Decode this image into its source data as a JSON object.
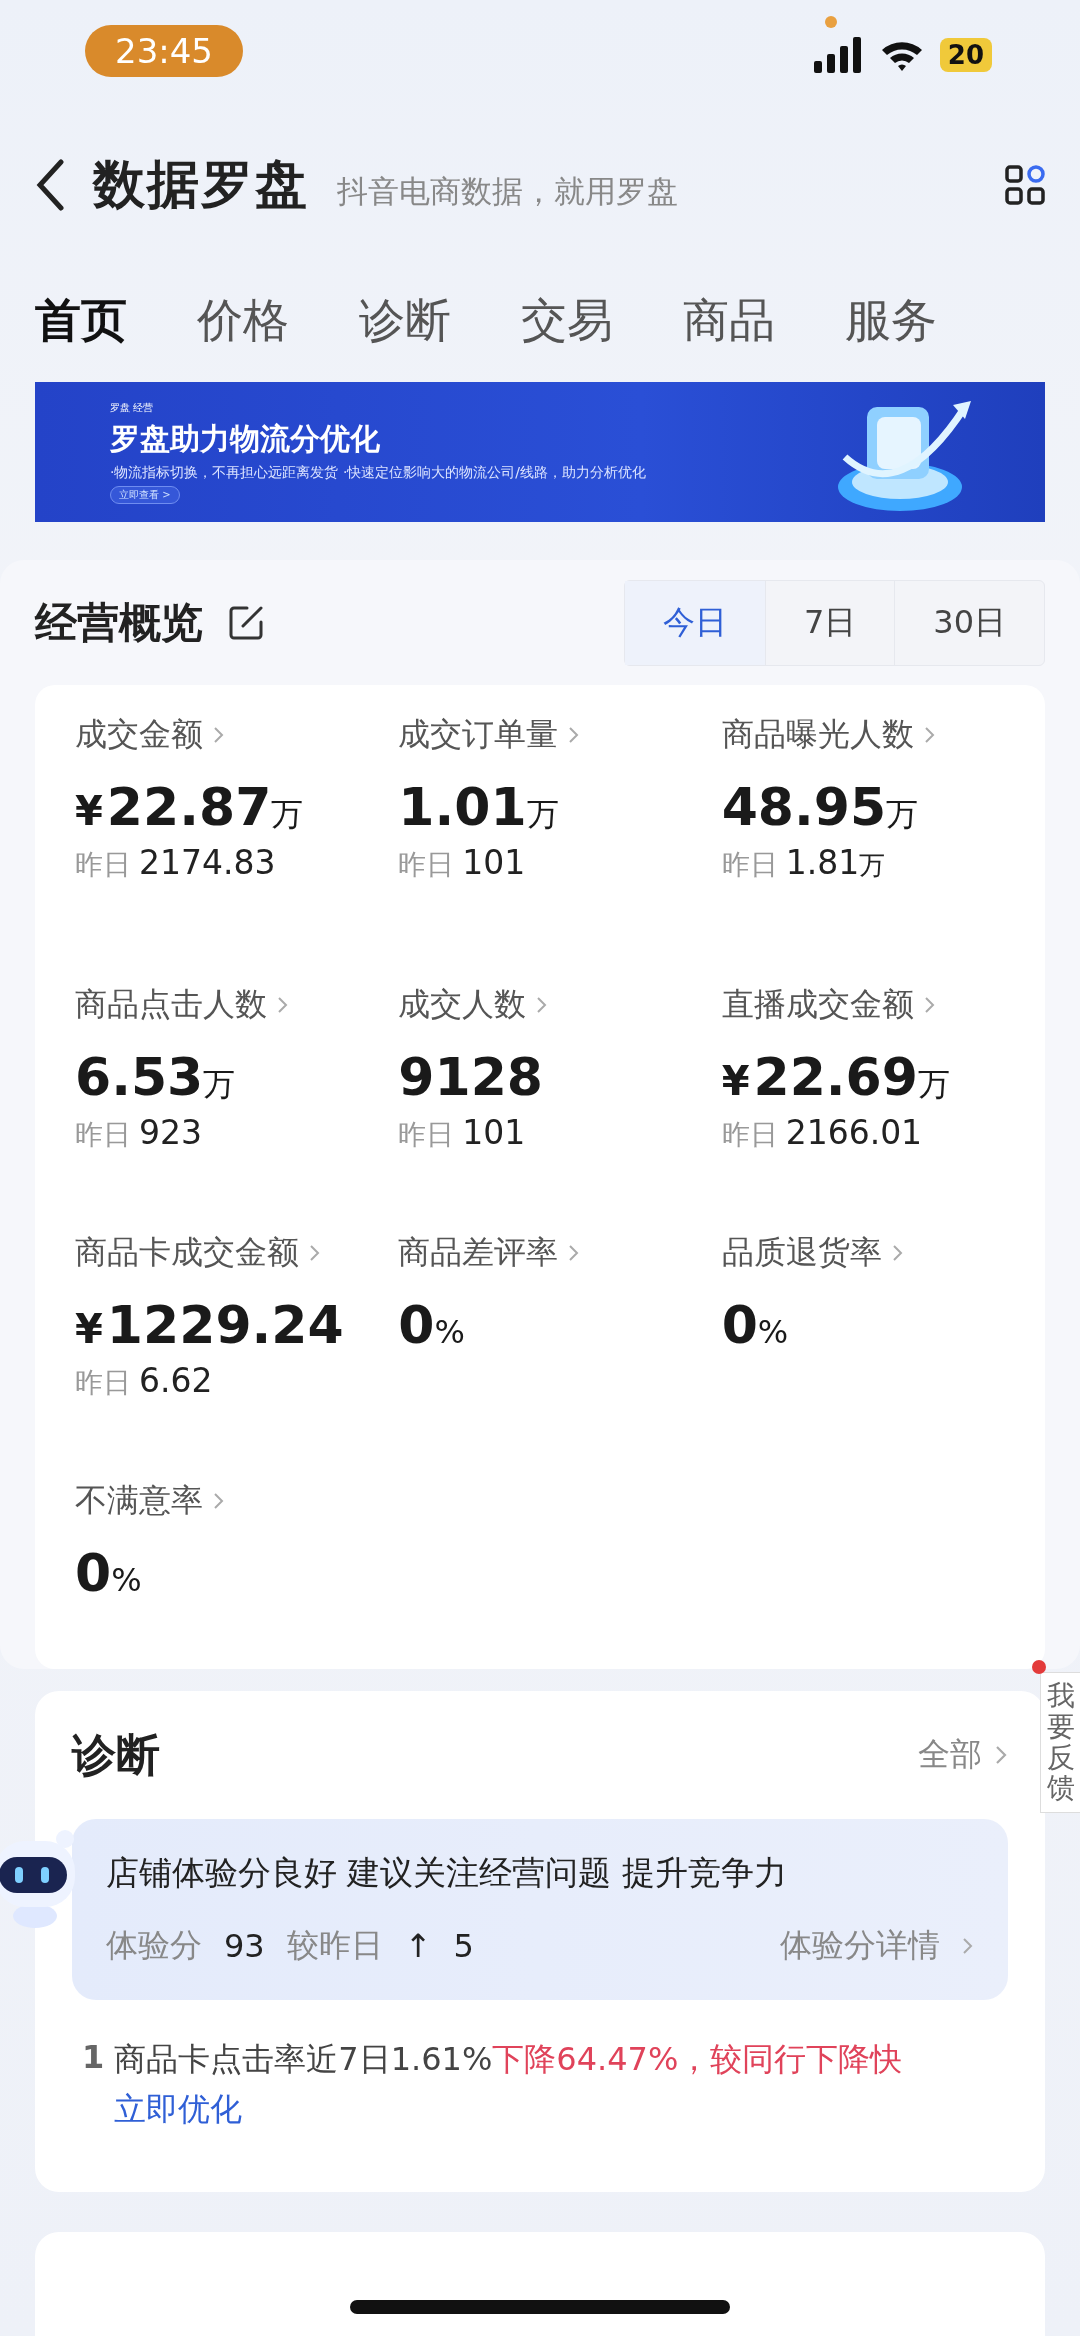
{
  "status_bar": {
    "time": "23:45",
    "battery": "20"
  },
  "header": {
    "title": "数据罗盘",
    "subtitle": "抖音电商数据，就用罗盘"
  },
  "tabs": [
    {
      "label": "首页",
      "selected": true
    },
    {
      "label": "价格",
      "selected": false
    },
    {
      "label": "诊断",
      "selected": false
    },
    {
      "label": "交易",
      "selected": false
    },
    {
      "label": "商品",
      "selected": false
    },
    {
      "label": "服务",
      "selected": false
    }
  ],
  "banner": {
    "logo": "罗盘 经营",
    "title": "罗盘助力物流分优化",
    "subtitle": "·物流指标切换，不再担心远距离发货 ·快速定位影响大的物流公司/线路，助力分析优化",
    "button": "立即查看 >"
  },
  "overview": {
    "title": "经营概览",
    "periods": [
      {
        "label": "今日",
        "selected": true
      },
      {
        "label": "7日",
        "selected": false
      },
      {
        "label": "30日",
        "selected": false
      }
    ],
    "metrics": [
      {
        "label": "成交金额",
        "currency": "¥",
        "value": "22.87",
        "unit": "万",
        "yesterday_label": "昨日",
        "yesterday": "2174.83"
      },
      {
        "label": "成交订单量",
        "value": "1.01",
        "unit": "万",
        "yesterday_label": "昨日",
        "yesterday": "101"
      },
      {
        "label": "商品曝光人数",
        "value": "48.95",
        "unit": "万",
        "yesterday_label": "昨日",
        "yesterday": "1.81",
        "yesterday_unit": "万"
      },
      {
        "label": "商品点击人数",
        "value": "6.53",
        "unit": "万",
        "yesterday_label": "昨日",
        "yesterday": "923"
      },
      {
        "label": "成交人数",
        "value": "9128",
        "yesterday_label": "昨日",
        "yesterday": "101"
      },
      {
        "label": "直播成交金额",
        "currency": "¥",
        "value": "22.69",
        "unit": "万",
        "yesterday_label": "昨日",
        "yesterday": "2166.01"
      },
      {
        "label": "商品卡成交金额",
        "currency": "¥",
        "value": "1229.24",
        "yesterday_label": "昨日",
        "yesterday": "6.62"
      },
      {
        "label": "商品差评率",
        "value": "0",
        "unit": "%"
      },
      {
        "label": "品质退货率",
        "value": "0",
        "unit": "%"
      },
      {
        "label": "不满意率",
        "value": "0",
        "unit": "%"
      }
    ]
  },
  "feedback": {
    "label": "我要反馈"
  },
  "diagnosis": {
    "title": "诊断",
    "all": "全部",
    "summary": "店铺体验分良好 建议关注经营问题 提升竞争力",
    "score_label": "体验分",
    "score": "93",
    "compare_label": "较昨日",
    "arrow": "↑",
    "change": "5",
    "detail": "体验分详情",
    "issues": [
      {
        "index": "1",
        "text": "商品卡点击率近7日1.61%",
        "alert": "下降64.47%，较同行下降快",
        "action": "立即优化"
      }
    ]
  }
}
